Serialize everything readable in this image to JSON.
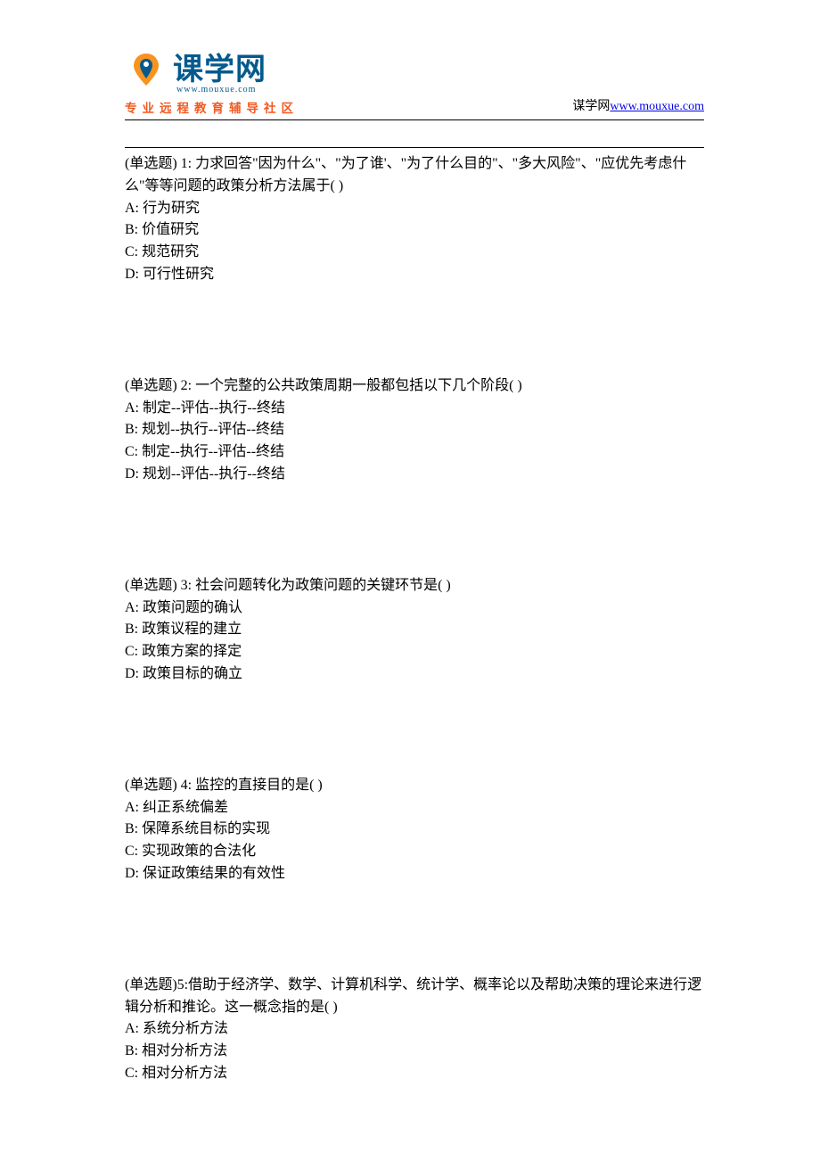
{
  "header": {
    "logo_main": "课学网",
    "logo_sub": "www.mouxue.com",
    "tagline": "专业远程教育辅导社区",
    "site_label": "谋学网",
    "site_url": "www.mouxue.com"
  },
  "questions": [
    {
      "stem": "(单选题) 1: 力求回答\"因为什么\"、\"为了谁'、\"为了什么目的\"、\"多大风险\"、\"应优先考虑什么\"等等问题的政策分析方法属于( )",
      "options": [
        "A: 行为研究",
        "B: 价值研究",
        "C: 规范研究",
        "D: 可行性研究"
      ]
    },
    {
      "stem": "(单选题) 2: 一个完整的公共政策周期一般都包括以下几个阶段( )",
      "options": [
        "A: 制定--评估--执行--终结",
        "B: 规划--执行--评估--终结",
        "C: 制定--执行--评估--终结",
        "D: 规划--评估--执行--终结"
      ]
    },
    {
      "stem": "(单选题) 3: 社会问题转化为政策问题的关键环节是( )",
      "options": [
        "A: 政策问题的确认",
        "B: 政策议程的建立",
        "C: 政策方案的择定",
        "D: 政策目标的确立"
      ]
    },
    {
      "stem": "(单选题) 4: 监控的直接目的是( )",
      "options": [
        "A: 纠正系统偏差",
        "B: 保障系统目标的实现",
        "C: 实现政策的合法化",
        "D: 保证政策结果的有效性"
      ]
    },
    {
      "stem": "(单选题)5:借助于经济学、数学、计算机科学、统计学、概率论以及帮助决策的理论来进行逻辑分析和推论。这一概念指的是( )",
      "options": [
        "A: 系统分析方法",
        "B: 相对分析方法",
        "C: 相对分析方法"
      ]
    }
  ]
}
